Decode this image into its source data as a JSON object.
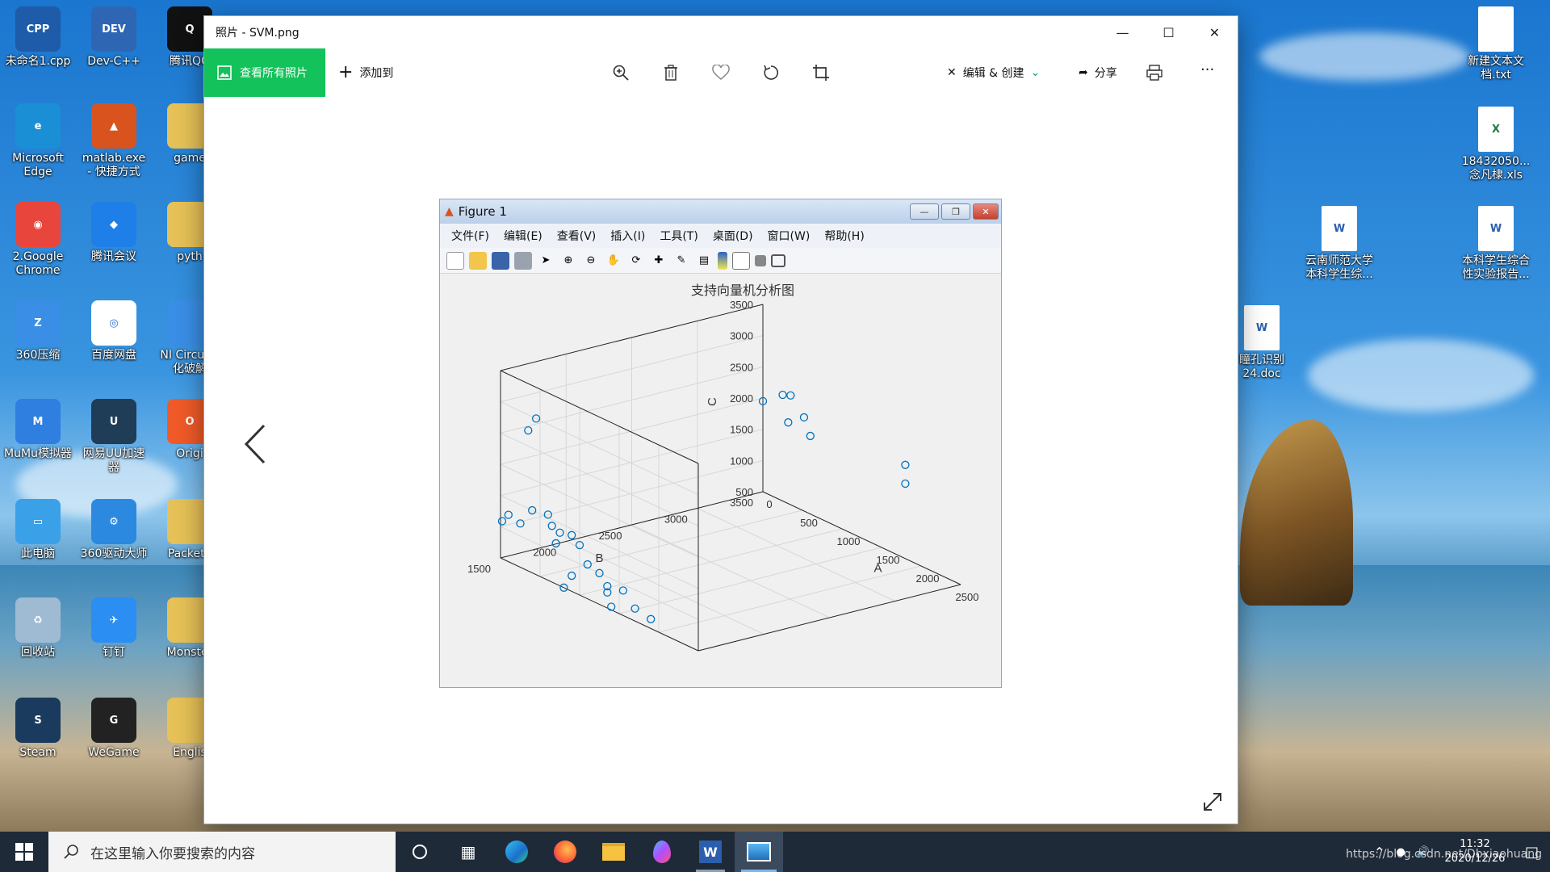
{
  "desktop": {
    "icons_left": [
      {
        "label": "未命名1.cpp",
        "badge": "CPP",
        "color": "#1e5ba8"
      },
      {
        "label": "Microsoft Edge",
        "badge": "e",
        "color": "#1b8fd6"
      },
      {
        "label": "2.Google Chrome",
        "badge": "◉",
        "color": "#e8453c"
      },
      {
        "label": "360压缩",
        "badge": "Z",
        "color": "#3a8ee6"
      },
      {
        "label": "MuMu模拟器",
        "badge": "M",
        "color": "#2e7fe0"
      },
      {
        "label": "此电脑",
        "badge": "▭",
        "color": "#3aa0e8"
      },
      {
        "label": "回收站",
        "badge": "♻",
        "color": "#9fbbd4"
      },
      {
        "label": "Steam",
        "badge": "S",
        "color": "#1a3a5e"
      }
    ],
    "icons_mid": [
      {
        "label": "Dev-C++",
        "badge": "DEV",
        "color": "#2f66b3"
      },
      {
        "label": "matlab.exe - 快捷方式",
        "badge": "▲",
        "color": "#d9531e"
      },
      {
        "label": "腾讯会议",
        "badge": "◆",
        "color": "#1f7fe8"
      },
      {
        "label": "百度网盘",
        "badge": "◎",
        "color": "#ffffff"
      },
      {
        "label": "网易UU加速器",
        "badge": "U",
        "color": "#1f3d57"
      },
      {
        "label": "360驱动大师",
        "badge": "⚙",
        "color": "#2b8ae0"
      },
      {
        "label": "钉钉",
        "badge": "✈",
        "color": "#2a8ef2"
      },
      {
        "label": "WeGame",
        "badge": "G",
        "color": "#222222"
      }
    ],
    "icons_third": [
      {
        "label": "腾讯QQ",
        "badge": "Q",
        "color": "#111111"
      },
      {
        "label": "game",
        "badge": "",
        "color": "#e6c157"
      },
      {
        "label": "pyth",
        "badge": "",
        "color": "#e6c157"
      },
      {
        "label": "NI Circu 汉化破解",
        "badge": "",
        "color": "#3a8ee6"
      },
      {
        "label": "Origi",
        "badge": "O",
        "color": "#f05a28"
      },
      {
        "label": "PacketT",
        "badge": "",
        "color": "#e6c157"
      },
      {
        "label": "Monster",
        "badge": "",
        "color": "#e6c157"
      },
      {
        "label": "Englis",
        "badge": "",
        "color": "#e6c157"
      }
    ],
    "icons_right": [
      {
        "label": "新建文本文档.txt",
        "badge": "",
        "color": "#ffffff"
      },
      {
        "label": "18432050... 念凡棣.xls",
        "badge": "X",
        "color": "#1e7b45"
      },
      {
        "label": "云南师范大学本科学生综...",
        "badge": "W",
        "color": "#2b5fae"
      },
      {
        "label": "本科学生综合性实验报告...",
        "badge": "W",
        "color": "#2b5fae"
      },
      {
        "label": "瞳孔识别24.doc",
        "badge": "W",
        "color": "#2b5fae"
      }
    ]
  },
  "photos": {
    "title": "照片 - SVM.png",
    "view_all": "查看所有照片",
    "add_to": "添加到",
    "edit_create": "编辑 & 创建",
    "share": "分享",
    "more": "···"
  },
  "figure": {
    "title": "Figure 1",
    "menu": [
      "文件(F)",
      "编辑(E)",
      "查看(V)",
      "插入(I)",
      "工具(T)",
      "桌面(D)",
      "窗口(W)",
      "帮助(H)"
    ]
  },
  "chart_data": {
    "type": "scatter",
    "title": "支持向量机分析图",
    "xlabel": "A",
    "ylabel": "B",
    "zlabel": "C",
    "xlim": [
      0,
      2500
    ],
    "ylim": [
      1500,
      3500
    ],
    "zlim": [
      500,
      3500
    ],
    "x_ticks": [
      0,
      500,
      1000,
      1500,
      2000,
      2500
    ],
    "y_ticks": [
      1500,
      2000,
      2500,
      3000,
      3500
    ],
    "z_ticks": [
      500,
      1000,
      1500,
      2000,
      2500,
      3000,
      3500
    ],
    "grid": true,
    "marker": "circle",
    "color": "#0072bd",
    "points": [
      {
        "x": 0,
        "y": 3500,
        "z": 1950
      },
      {
        "x": 250,
        "y": 3500,
        "z": 2200
      },
      {
        "x": 350,
        "y": 3500,
        "z": 2250
      },
      {
        "x": 520,
        "y": 3500,
        "z": 2000
      },
      {
        "x": 320,
        "y": 3500,
        "z": 1800
      },
      {
        "x": 600,
        "y": 3500,
        "z": 1750
      },
      {
        "x": 1800,
        "y": 3500,
        "z": 1700
      },
      {
        "x": 1800,
        "y": 3500,
        "z": 2000
      },
      {
        "x": 400,
        "y": 1500,
        "z": 1500
      },
      {
        "x": 250,
        "y": 1500,
        "z": 1200
      },
      {
        "x": 100,
        "y": 1500,
        "z": 1250
      },
      {
        "x": 20,
        "y": 1500,
        "z": 1100
      },
      {
        "x": 600,
        "y": 1500,
        "z": 1550
      },
      {
        "x": 450,
        "y": 1500,
        "z": 3000
      },
      {
        "x": 350,
        "y": 1500,
        "z": 2750
      },
      {
        "x": 650,
        "y": 1500,
        "z": 1400
      },
      {
        "x": 750,
        "y": 1500,
        "z": 1350
      },
      {
        "x": 700,
        "y": 1500,
        "z": 1150
      },
      {
        "x": 900,
        "y": 1500,
        "z": 1400
      },
      {
        "x": 1000,
        "y": 1500,
        "z": 1300
      },
      {
        "x": 1100,
        "y": 1500,
        "z": 1050
      },
      {
        "x": 1250,
        "y": 1500,
        "z": 1000
      },
      {
        "x": 1350,
        "y": 1500,
        "z": 750
      },
      {
        "x": 1350,
        "y": 1500,
        "z": 850
      },
      {
        "x": 1550,
        "y": 1500,
        "z": 900
      },
      {
        "x": 1700,
        "y": 1500,
        "z": 700
      },
      {
        "x": 1400,
        "y": 1500,
        "z": 550
      },
      {
        "x": 1900,
        "y": 1500,
        "z": 650
      },
      {
        "x": 900,
        "y": 1500,
        "z": 750
      },
      {
        "x": 800,
        "y": 1500,
        "z": 500
      }
    ]
  },
  "taskbar": {
    "search_placeholder": "在这里输入你要搜索的内容",
    "time": "11:32",
    "date": "2020/12/26"
  },
  "watermark": "https://blog.csdn.net/Dbxiaohuang"
}
